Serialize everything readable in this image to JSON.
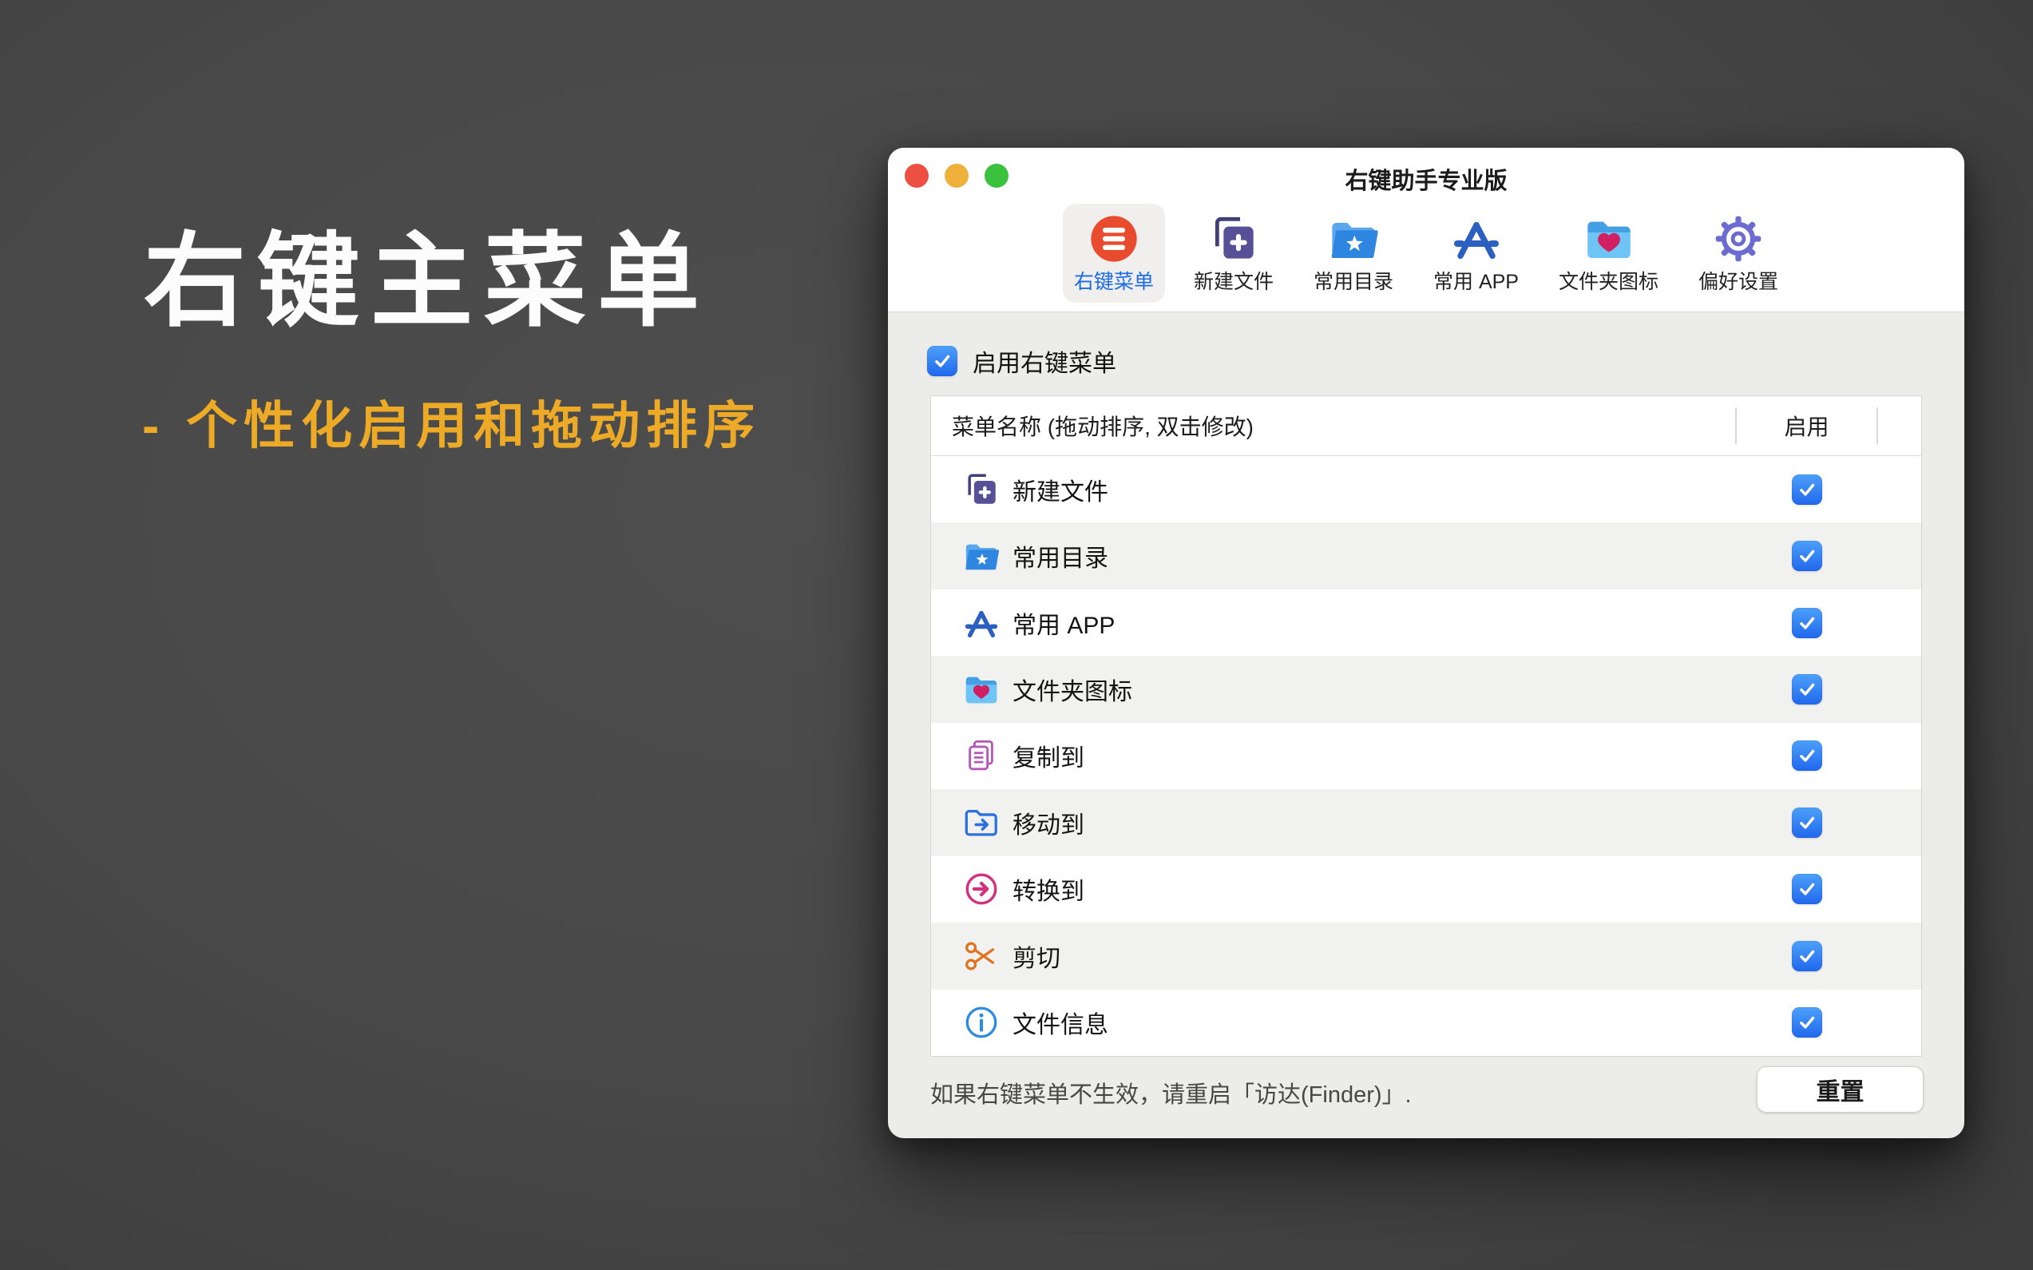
{
  "hero": {
    "title": "右键主菜单",
    "subtitle": "- 个性化启用和拖动排序",
    "title_color": "#fcfcfc",
    "subtitle_color": "#edaa26"
  },
  "window": {
    "title": "右键助手专业版",
    "traffic_lights": [
      "close",
      "minimize",
      "zoom"
    ],
    "toolbar": {
      "items": [
        {
          "name": "right-click-menu",
          "label": "右键菜单",
          "icon": "menu-circle-icon",
          "selected": true
        },
        {
          "name": "new-file",
          "label": "新建文件",
          "icon": "new-file-icon",
          "selected": false
        },
        {
          "name": "favorite-folders",
          "label": "常用目录",
          "icon": "folder-star-icon",
          "selected": false
        },
        {
          "name": "favorite-apps",
          "label": "常用 APP",
          "icon": "appstore-a-icon",
          "selected": false
        },
        {
          "name": "folder-icons",
          "label": "文件夹图标",
          "icon": "folder-heart-icon",
          "selected": false
        },
        {
          "name": "preferences",
          "label": "偏好设置",
          "icon": "gear-icon",
          "selected": false
        }
      ]
    },
    "enable_checkbox": {
      "label": "启用右键菜单",
      "checked": true
    },
    "table": {
      "columns": {
        "name": "菜单名称 (拖动排序, 双击修改)",
        "enabled": "启用"
      },
      "rows": [
        {
          "name": "new-file",
          "label": "新建文件",
          "icon": "new-file-icon",
          "enabled": true
        },
        {
          "name": "favorite-folders",
          "label": "常用目录",
          "icon": "folder-star-icon",
          "enabled": true
        },
        {
          "name": "favorite-apps",
          "label": "常用 APP",
          "icon": "appstore-a-icon",
          "enabled": true
        },
        {
          "name": "folder-icons",
          "label": "文件夹图标",
          "icon": "folder-heart-icon",
          "enabled": true
        },
        {
          "name": "copy-to",
          "label": "复制到",
          "icon": "copy-pages-icon",
          "enabled": true
        },
        {
          "name": "move-to",
          "label": "移动到",
          "icon": "folder-arrow-icon",
          "enabled": true
        },
        {
          "name": "convert-to",
          "label": "转换到",
          "icon": "circle-arrow-icon",
          "enabled": true
        },
        {
          "name": "cut",
          "label": "剪切",
          "icon": "scissors-icon",
          "enabled": true
        },
        {
          "name": "file-info",
          "label": "文件信息",
          "icon": "info-circle-icon",
          "enabled": true
        }
      ]
    },
    "footer": {
      "hint": "如果右键菜单不生效，请重启「访达(Finder)」.",
      "reset_label": "重置"
    }
  },
  "colors": {
    "desktop_bg": "#4a4a4a",
    "accent_blue": "#1a6ce5",
    "checkbox_blue": "#2f7ff2",
    "selected_tab_bg": "#f0efee",
    "window_content_bg": "#ececeb",
    "menu_icon_red": "#e84b2d",
    "subtitle_yellow": "#edaa26"
  }
}
